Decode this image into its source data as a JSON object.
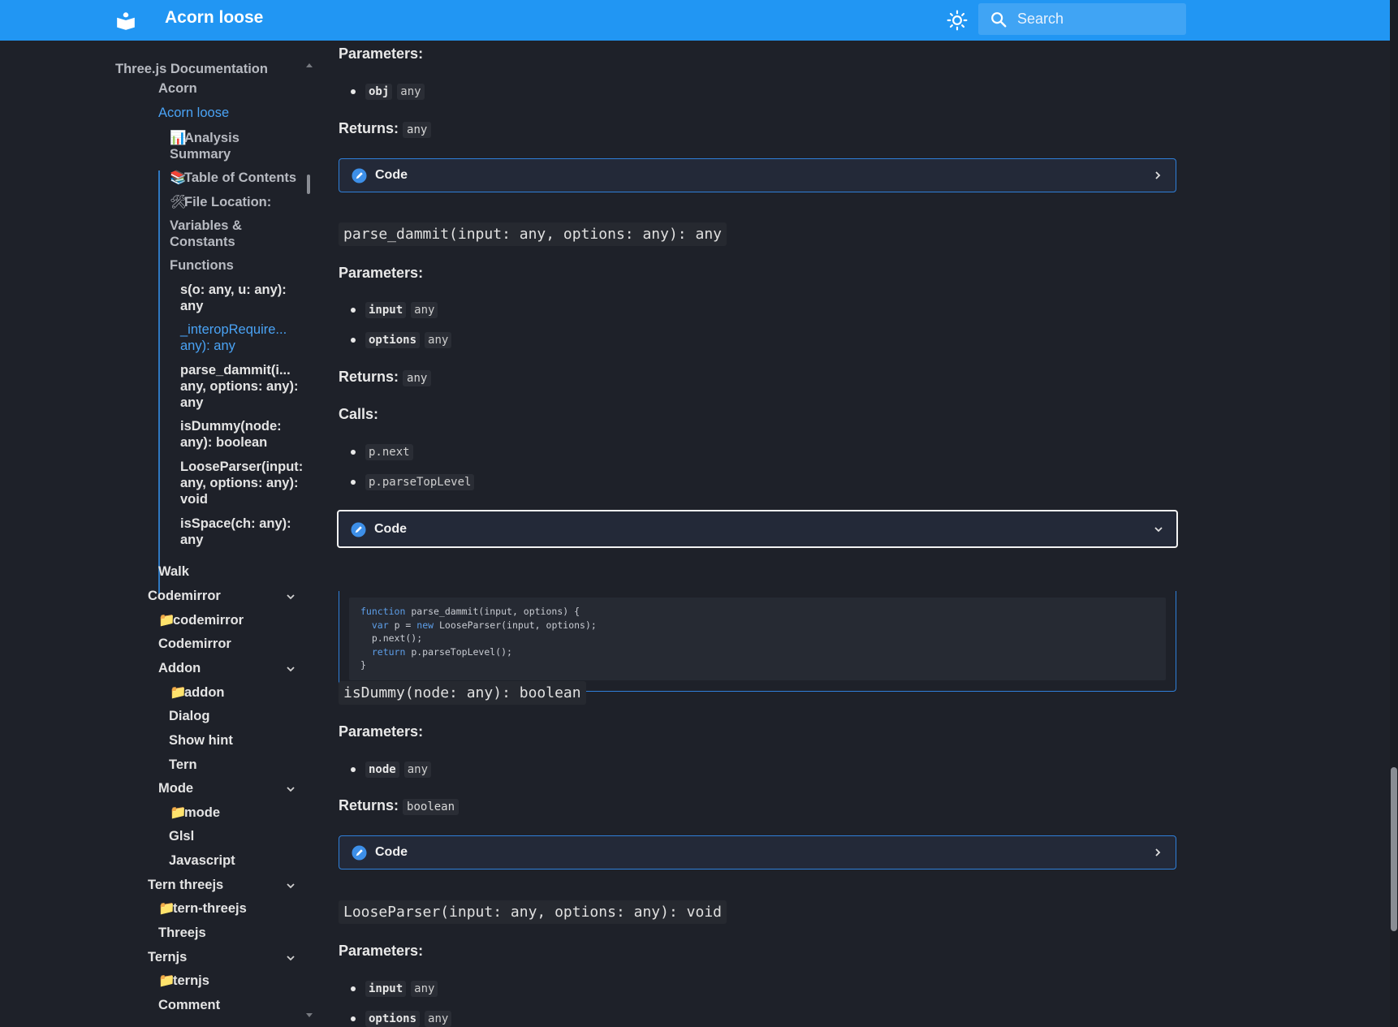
{
  "header": {
    "title": "Acorn loose",
    "search_placeholder": "Search",
    "brand_color": "#2196f3"
  },
  "sidebar": {
    "root": "Three.js Documentation",
    "acorn": "Acorn",
    "acorn_loose": "Acorn loose",
    "toc": {
      "analysis_icon": "📊",
      "analysis": "Analysis Summary",
      "table_icon": "📚",
      "table": "Table of Contents",
      "file_icon": "🛠",
      "file": "File Location:",
      "variables": "Variables & Constants",
      "functions": "Functions",
      "fn_s": "s(o: any, u: any): any",
      "fn_interop": "_interopRequire... any): any",
      "fn_parse": "parse_dammit(i... any, options: any): any",
      "fn_isdummy": "isDummy(node: any): boolean",
      "fn_looseparser": "LooseParser(input: any, options: any): void",
      "fn_isspace": "isSpace(ch: any): any"
    },
    "walk": "Walk",
    "codemirror": "Codemirror",
    "codemirror_folder": "codemirror",
    "codemirror_page": "Codemirror",
    "addon": "Addon",
    "addon_folder": "addon",
    "dialog": "Dialog",
    "show_hint": "Show hint",
    "tern": "Tern",
    "mode": "Mode",
    "mode_folder": "mode",
    "glsl": "Glsl",
    "javascript": "Javascript",
    "tern_threejs": "Tern threejs",
    "tern_threejs_folder": "tern-threejs",
    "threejs": "Threejs",
    "ternjs": "Ternjs",
    "ternjs_folder": "ternjs",
    "comment": "Comment"
  },
  "main": {
    "parameters_label": "Parameters:",
    "returns_label": "Returns:",
    "calls_label": "Calls:",
    "code_label": "Code",
    "block1": {
      "params": [
        {
          "name": "obj",
          "type": "any"
        }
      ],
      "returns": "any"
    },
    "block2": {
      "signature": "parse_dammit(input: any, options: any): any",
      "params": [
        {
          "name": "input",
          "type": "any"
        },
        {
          "name": "options",
          "type": "any"
        }
      ],
      "returns": "any",
      "calls": [
        "p.next",
        "p.parseTopLevel"
      ],
      "code": {
        "l1_kw": "function",
        "l1_rest": " parse_dammit(input, options) {",
        "l2_kw": "var",
        "l2_mid": " p = ",
        "l2_kw2": "new",
        "l2_rest": " LooseParser(input, options);",
        "l3": "  p.next();",
        "l4_kw": "return",
        "l4_rest": " p.parseTopLevel();",
        "l5": "}"
      }
    },
    "block3": {
      "signature": "isDummy(node: any): boolean",
      "params": [
        {
          "name": "node",
          "type": "any"
        }
      ],
      "returns": "boolean"
    },
    "block4": {
      "signature": "LooseParser(input: any, options: any): void",
      "params": [
        {
          "name": "input",
          "type": "any"
        },
        {
          "name": "options",
          "type": "any"
        }
      ]
    }
  }
}
